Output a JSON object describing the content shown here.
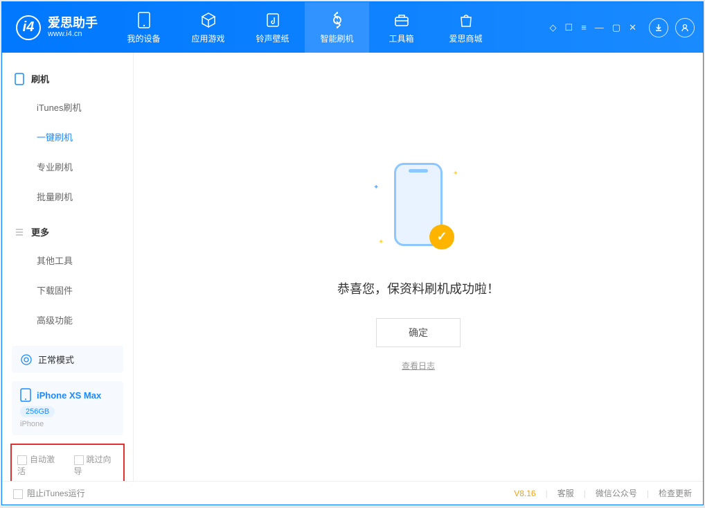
{
  "app": {
    "title": "爱思助手",
    "url": "www.i4.cn"
  },
  "nav": {
    "device": "我的设备",
    "apps": "应用游戏",
    "ringtones": "铃声壁纸",
    "flash": "智能刷机",
    "toolbox": "工具箱",
    "store": "爱思商城"
  },
  "sidebar": {
    "flash_group": "刷机",
    "items": {
      "itunes": "iTunes刷机",
      "onekey": "一键刷机",
      "pro": "专业刷机",
      "batch": "批量刷机"
    },
    "more_group": "更多",
    "more": {
      "other": "其他工具",
      "firmware": "下载固件",
      "advanced": "高级功能"
    },
    "mode_label": "正常模式",
    "device": {
      "name": "iPhone XS Max",
      "storage": "256GB",
      "type": "iPhone"
    },
    "opts": {
      "auto_activate": "自动激活",
      "skip_guide": "跳过向导"
    }
  },
  "main": {
    "message": "恭喜您，保资料刷机成功啦！",
    "ok": "确定",
    "view_log": "查看日志"
  },
  "footer": {
    "block_itunes": "阻止iTunes运行",
    "version": "V8.16",
    "support": "客服",
    "wechat": "微信公众号",
    "update": "检查更新"
  }
}
